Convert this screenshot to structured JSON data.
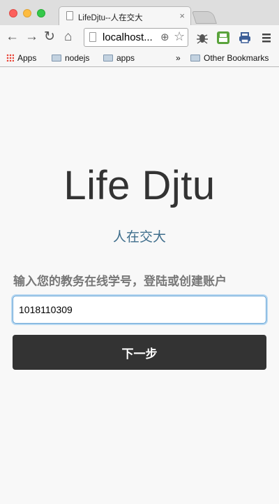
{
  "browser": {
    "tab_title": "LifeDjtu--人在交大",
    "tab_close": "×",
    "url": "localhost...",
    "bookmarks": [
      {
        "label": "Apps",
        "icon": "apps-grid-icon"
      },
      {
        "label": "nodejs",
        "icon": "folder-icon"
      },
      {
        "label": "apps",
        "icon": "folder-icon"
      }
    ],
    "overflow": "»",
    "other_bookmarks": "Other Bookmarks"
  },
  "page": {
    "brand": "Life Djtu",
    "subtitle": "人在交大",
    "prompt": "输入您的教务在线学号，登陆或创建账户",
    "student_id_value": "1018110309",
    "next_button": "下一步"
  },
  "colors": {
    "subtitle": "#3f6e8c",
    "button_bg": "#333333",
    "focus_ring": "#69a5d6"
  }
}
